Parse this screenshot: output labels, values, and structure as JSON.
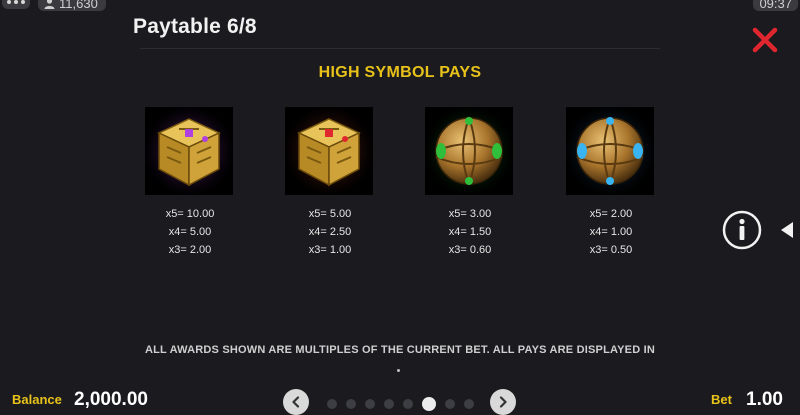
{
  "status_bar": {
    "player_count": "11,630",
    "clock": "09:37"
  },
  "header": {
    "title": "Paytable 6/8"
  },
  "section": {
    "heading": "HIGH SYMBOL PAYS"
  },
  "symbols": [
    {
      "icon": "purple-gold-cube-symbol",
      "glow": "#b040e0",
      "pays": [
        "x5= 10.00",
        "x4= 5.00",
        "x3= 2.00"
      ]
    },
    {
      "icon": "red-gold-cube-symbol",
      "glow": "#d24a2a",
      "pays": [
        "x5= 5.00",
        "x4= 2.50",
        "x3= 1.00"
      ]
    },
    {
      "icon": "green-gem-orb-symbol",
      "glow": "#2fbf3a",
      "pays": [
        "x5= 3.00",
        "x4= 1.50",
        "x3= 0.60"
      ]
    },
    {
      "icon": "blue-gem-orb-symbol",
      "glow": "#3a8fe0",
      "pays": [
        "x5= 2.00",
        "x4= 1.00",
        "x3= 0.50"
      ]
    }
  ],
  "footer_note": "ALL AWARDS SHOWN ARE MULTIPLES OF THE CURRENT BET. ALL PAYS ARE DISPLAYED IN",
  "bottom_bar": {
    "balance_label": "Balance",
    "balance_value": "2,000.00",
    "bet_label": "Bet",
    "bet_value": "1.00"
  },
  "pagination": {
    "total_pages": 8,
    "current_page": 6
  },
  "colors": {
    "accent_gold": "#e8c21a",
    "close_red": "#e0262e",
    "background": "#1b1b1f"
  }
}
